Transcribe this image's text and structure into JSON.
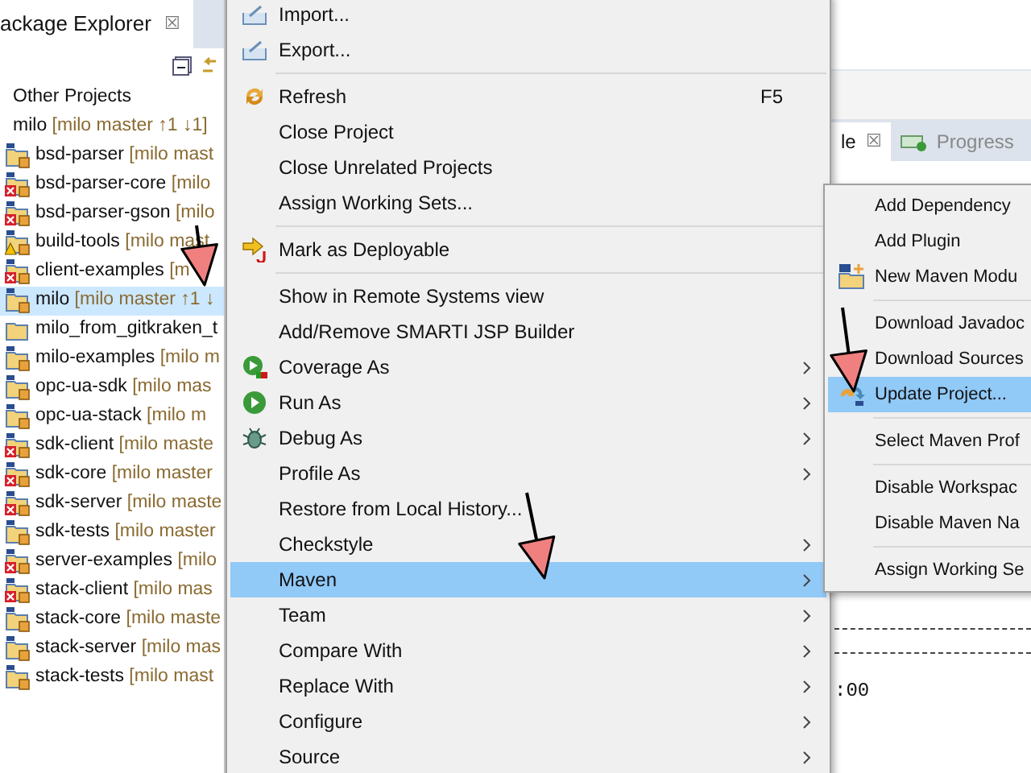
{
  "explorer": {
    "tab_title": "ackage Explorer",
    "close": "☒",
    "tree": [
      {
        "label": "Other Projects",
        "children": [
          {
            "label": "milo",
            "branch": "[milo master ↑1 ↓1]",
            "children": [
              {
                "label": "bsd-parser",
                "branch": "[milo mast",
                "kind": "maven",
                "selected": false
              },
              {
                "label": "bsd-parser-core",
                "branch": "[milo",
                "kind": "error",
                "selected": false
              },
              {
                "label": "bsd-parser-gson",
                "branch": "[milo",
                "kind": "error",
                "selected": false
              },
              {
                "label": "build-tools",
                "branch": "[milo mast",
                "kind": "warning",
                "selected": false
              },
              {
                "label": "client-examples",
                "branch": "[m",
                "kind": "error",
                "selected": false
              },
              {
                "label": "milo",
                "branch": "[milo master ↑1 ↓",
                "kind": "maven",
                "selected": true
              },
              {
                "label": "milo_from_gitkraken_t",
                "kind": "folder",
                "selected": false
              },
              {
                "label": "milo-examples",
                "branch": "[milo m",
                "kind": "maven",
                "selected": false
              },
              {
                "label": "opc-ua-sdk",
                "branch": "[milo mas",
                "kind": "maven",
                "selected": false
              },
              {
                "label": "opc-ua-stack",
                "branch": "[milo m",
                "kind": "maven",
                "selected": false
              },
              {
                "label": "sdk-client",
                "branch": "[milo maste",
                "kind": "error",
                "selected": false
              },
              {
                "label": "sdk-core",
                "branch": "[milo master",
                "kind": "error",
                "selected": false
              },
              {
                "label": "sdk-server",
                "branch": "[milo maste",
                "kind": "error",
                "selected": false
              },
              {
                "label": "sdk-tests",
                "branch": "[milo master",
                "kind": "maven",
                "selected": false
              },
              {
                "label": "server-examples",
                "branch": "[milo",
                "kind": "error",
                "selected": false
              },
              {
                "label": "stack-client",
                "branch": "[milo mas",
                "kind": "error",
                "selected": false
              },
              {
                "label": "stack-core",
                "branch": "[milo maste",
                "kind": "maven",
                "selected": false
              },
              {
                "label": "stack-server",
                "branch": "[milo mas",
                "kind": "maven",
                "selected": false
              },
              {
                "label": "stack-tests",
                "branch": "[milo mast",
                "kind": "maven",
                "selected": false
              }
            ]
          }
        ]
      }
    ]
  },
  "console": {
    "tabs": [
      {
        "label": "le",
        "close": "☒",
        "selected": true
      },
      {
        "label": "Progress",
        "selected": false
      }
    ],
    "time_text": ":00"
  },
  "context_menu": {
    "items": [
      {
        "kind": "item",
        "label": "Import...",
        "selected": false
      },
      {
        "kind": "item",
        "label": "Export...",
        "selected": false
      },
      {
        "kind": "separator"
      },
      {
        "kind": "item",
        "label": "Refresh",
        "shortcut": "F5",
        "selected": false
      },
      {
        "kind": "item",
        "label": "Close Project",
        "selected": false
      },
      {
        "kind": "item",
        "label": "Close Unrelated Projects",
        "selected": false
      },
      {
        "kind": "item",
        "label": "Assign Working Sets...",
        "selected": false
      },
      {
        "kind": "separator"
      },
      {
        "kind": "item",
        "label": "Mark as Deployable",
        "selected": false
      },
      {
        "kind": "separator"
      },
      {
        "kind": "item",
        "label": "Show in Remote Systems view",
        "selected": false
      },
      {
        "kind": "item",
        "label": "Add/Remove SMARTI JSP Builder",
        "selected": false
      },
      {
        "kind": "submenu",
        "label": "Coverage As",
        "selected": false
      },
      {
        "kind": "submenu",
        "label": "Run As",
        "selected": false
      },
      {
        "kind": "submenu",
        "label": "Debug As",
        "selected": false
      },
      {
        "kind": "submenu",
        "label": "Profile As",
        "selected": false
      },
      {
        "kind": "item",
        "label": "Restore from Local History...",
        "selected": false
      },
      {
        "kind": "submenu",
        "label": "Checkstyle",
        "selected": false
      },
      {
        "kind": "submenu",
        "label": "Maven",
        "selected": true
      },
      {
        "kind": "submenu",
        "label": "Team",
        "selected": false
      },
      {
        "kind": "submenu",
        "label": "Compare With",
        "selected": false
      },
      {
        "kind": "submenu",
        "label": "Replace With",
        "selected": false
      },
      {
        "kind": "submenu",
        "label": "Configure",
        "selected": false
      },
      {
        "kind": "submenu",
        "label": "Source",
        "selected": false
      }
    ]
  },
  "maven_menu": {
    "items": [
      {
        "kind": "item",
        "label": "Add Dependency",
        "selected": false
      },
      {
        "kind": "item",
        "label": "Add Plugin",
        "selected": false
      },
      {
        "kind": "item",
        "label": "New Maven Modu",
        "selected": false
      },
      {
        "kind": "separator"
      },
      {
        "kind": "item",
        "label": "Download Javadoc",
        "selected": false
      },
      {
        "kind": "item",
        "label": "Download Sources",
        "selected": false
      },
      {
        "kind": "item",
        "label": "Update Project...",
        "selected": true
      },
      {
        "kind": "separator"
      },
      {
        "kind": "item",
        "label": "Select Maven Prof",
        "selected": false
      },
      {
        "kind": "separator"
      },
      {
        "kind": "item",
        "label": "Disable Workspac",
        "selected": false
      },
      {
        "kind": "item",
        "label": "Disable Maven Na",
        "selected": false
      },
      {
        "kind": "separator"
      },
      {
        "kind": "item",
        "label": "Assign Working Se",
        "selected": false
      }
    ]
  }
}
